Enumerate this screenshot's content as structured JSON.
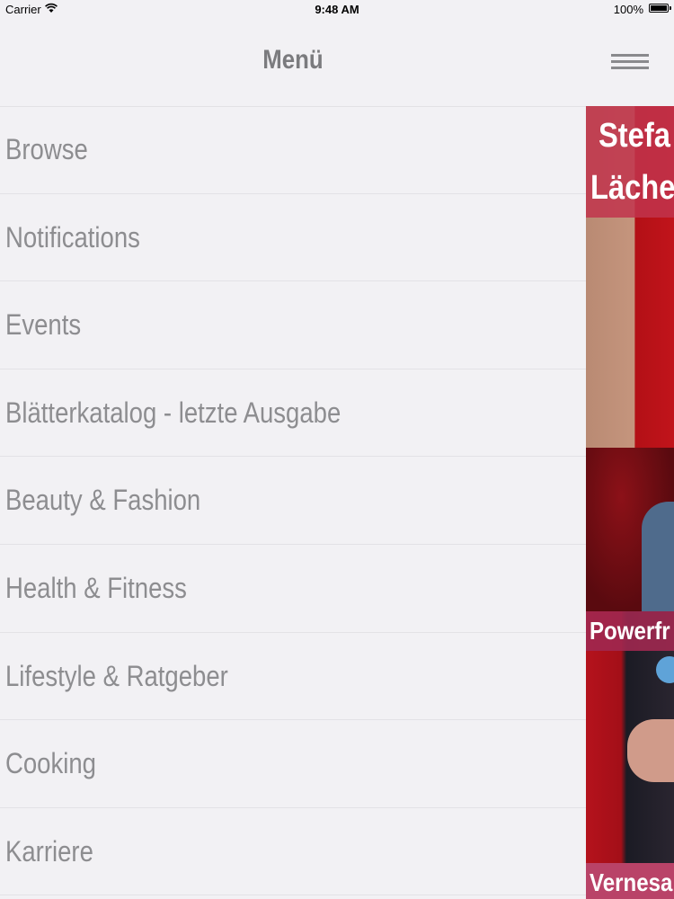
{
  "status_bar": {
    "carrier": "Carrier",
    "time": "9:48 AM",
    "battery": "100%"
  },
  "nav": {
    "title": "Menü",
    "menu_icon": "hamburger-icon"
  },
  "menu": {
    "items": [
      {
        "label": "Browse"
      },
      {
        "label": "Notifications"
      },
      {
        "label": "Events"
      },
      {
        "label": "Blätterkatalog - letzte Ausgabe"
      },
      {
        "label": "Beauty & Fashion"
      },
      {
        "label": "Health & Fitness"
      },
      {
        "label": "Lifestyle & Ratgeber"
      },
      {
        "label": "Cooking"
      },
      {
        "label": "Karriere"
      }
    ]
  },
  "content": {
    "cards": [
      {
        "caption_line1": "Stefa",
        "caption_line2": "Läche"
      },
      {
        "caption": "Powerfr"
      },
      {
        "caption": "Vernesa"
      }
    ]
  }
}
